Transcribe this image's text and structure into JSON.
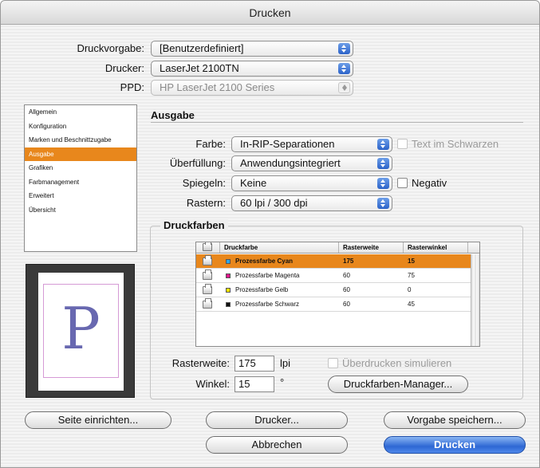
{
  "window": {
    "title": "Drucken"
  },
  "top": {
    "druckvorgabe_label": "Druckvorgabe:",
    "druckvorgabe_value": "[Benutzerdefiniert]",
    "drucker_label": "Drucker:",
    "drucker_value": "LaserJet 2100TN",
    "ppd_label": "PPD:",
    "ppd_value": "HP LaserJet 2100 Series"
  },
  "sidebar": {
    "items": [
      {
        "label": "Allgemein",
        "selected": false
      },
      {
        "label": "Konfiguration",
        "selected": false
      },
      {
        "label": "Marken und Beschnittzugabe",
        "selected": false
      },
      {
        "label": "Ausgabe",
        "selected": true
      },
      {
        "label": "Grafiken",
        "selected": false
      },
      {
        "label": "Farbmanagement",
        "selected": false
      },
      {
        "label": "Erweitert",
        "selected": false
      },
      {
        "label": "Übersicht",
        "selected": false
      }
    ]
  },
  "preview": {
    "letter": "P"
  },
  "ausgabe": {
    "title": "Ausgabe",
    "farbe_label": "Farbe:",
    "farbe_value": "In-RIP-Separationen",
    "text_schwarz_label": "Text im Schwarzen",
    "ueberfuellung_label": "Überfüllung:",
    "ueberfuellung_value": "Anwendungsintegriert",
    "spiegeln_label": "Spiegeln:",
    "spiegeln_value": "Keine",
    "negativ_label": "Negativ",
    "rastern_label": "Rastern:",
    "rastern_value": "60 lpi / 300 dpi"
  },
  "druckfarben": {
    "title": "Druckfarben",
    "headers": [
      "Druckfarbe",
      "Rasterweite",
      "Rasterwinkel"
    ],
    "rows": [
      {
        "name": "Prozessfarbe Cyan",
        "rasterweite": "175",
        "rasterwinkel": "15",
        "color": "#2ea8e8",
        "selected": true
      },
      {
        "name": "Prozessfarbe Magenta",
        "rasterweite": "60",
        "rasterwinkel": "75",
        "color": "#e0158c",
        "selected": false
      },
      {
        "name": "Prozessfarbe Gelb",
        "rasterweite": "60",
        "rasterwinkel": "0",
        "color": "#f5e500",
        "selected": false
      },
      {
        "name": "Prozessfarbe Schwarz",
        "rasterweite": "60",
        "rasterwinkel": "45",
        "color": "#111111",
        "selected": false
      }
    ],
    "rasterweite_label": "Rasterweite:",
    "rasterweite_value": "175",
    "rasterweite_unit": "lpi",
    "winkel_label": "Winkel:",
    "winkel_value": "15",
    "winkel_unit": "°",
    "ueberdrucken_label": "Überdrucken simulieren",
    "manager_button": "Druckfarben-Manager..."
  },
  "buttons": {
    "seite_einrichten": "Seite einrichten...",
    "drucker": "Drucker...",
    "vorgabe_speichern": "Vorgabe speichern...",
    "abbrechen": "Abbrechen",
    "drucken": "Drucken"
  }
}
